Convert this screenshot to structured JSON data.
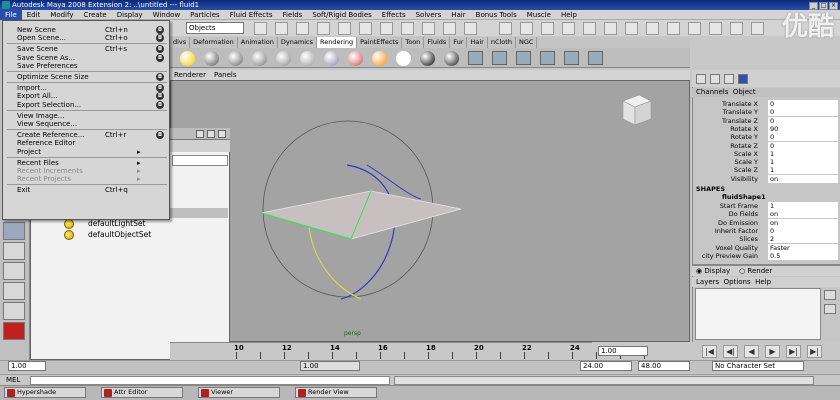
{
  "window": {
    "title": "Autodesk Maya 2008 Extension 2: ..\\untitled  ---  fluid1",
    "controls": [
      "_",
      "□",
      "×"
    ]
  },
  "menubar": [
    "File",
    "Edit",
    "Modify",
    "Create",
    "Display",
    "Window",
    "Particles",
    "Fluid Effects",
    "Fields",
    "Soft/Rigid Bodies",
    "Effects",
    "Solvers",
    "Hair",
    "Bonus Tools",
    "Muscle",
    "Help"
  ],
  "toolbar": {
    "object_field": "Objects"
  },
  "shelf_tabs": [
    "divs",
    "Deformation",
    "Animation",
    "Dynamics",
    "Rendering",
    "PaintEffects",
    "Toon",
    "Fluids",
    "Fur",
    "Hair",
    "nCloth",
    "NGC"
  ],
  "shelf_current": "Rendering",
  "viewport": {
    "menus": [
      "Renderer",
      "Panels"
    ],
    "camera_label": "persp"
  },
  "file_menu": {
    "items": [
      {
        "label": "New Scene",
        "shortcut": "Ctrl+n",
        "option": true
      },
      {
        "label": "Open Scene...",
        "shortcut": "Ctrl+o",
        "option": true
      },
      {
        "sep": true
      },
      {
        "label": "Save Scene",
        "shortcut": "Ctrl+s",
        "option": true
      },
      {
        "label": "Save Scene As...",
        "shortcut": "",
        "option": true
      },
      {
        "label": "Save Preferences",
        "shortcut": "",
        "option": false
      },
      {
        "sep": true
      },
      {
        "label": "Optimize Scene Size",
        "shortcut": "",
        "option": true
      },
      {
        "sep": true
      },
      {
        "label": "Import...",
        "shortcut": "",
        "option": true
      },
      {
        "label": "Export All...",
        "shortcut": "",
        "option": true
      },
      {
        "label": "Export Selection...",
        "shortcut": "",
        "option": true
      },
      {
        "sep": true
      },
      {
        "label": "View Image...",
        "shortcut": "",
        "option": false
      },
      {
        "label": "View Sequence...",
        "shortcut": "",
        "option": false
      },
      {
        "sep": true
      },
      {
        "label": "Create Reference...",
        "shortcut": "Ctrl+r",
        "option": true
      },
      {
        "label": "Reference Editor",
        "shortcut": "",
        "option": false
      },
      {
        "label": "Project",
        "shortcut": "",
        "option": false,
        "submenu": true
      },
      {
        "sep": true
      },
      {
        "label": "Recent Files",
        "shortcut": "",
        "option": false,
        "submenu": true
      },
      {
        "label": "Recent Increments",
        "shortcut": "",
        "option": false,
        "submenu": true,
        "disabled": true
      },
      {
        "label": "Recent Projects",
        "shortcut": "",
        "option": false,
        "submenu": true,
        "disabled": true
      },
      {
        "sep": true
      },
      {
        "label": "Exit",
        "shortcut": "Ctrl+q",
        "option": false
      }
    ]
  },
  "outliner": {
    "items": [
      "defaultLightSet",
      "defaultObjectSet"
    ]
  },
  "channel_box": {
    "header": [
      "Channels",
      "Object"
    ],
    "transform": [
      {
        "label": "Translate X",
        "value": "0"
      },
      {
        "label": "Translate Y",
        "value": "0"
      },
      {
        "label": "Translate Z",
        "value": "0"
      },
      {
        "label": "Rotate X",
        "value": "90"
      },
      {
        "label": "Rotate Y",
        "value": "0"
      },
      {
        "label": "Rotate Z",
        "value": "0"
      },
      {
        "label": "Scale X",
        "value": "1"
      },
      {
        "label": "Scale Y",
        "value": "1"
      },
      {
        "label": "Scale Z",
        "value": "1"
      },
      {
        "label": "Visibility",
        "value": "on"
      }
    ],
    "shapes_label": "SHAPES",
    "shape_name": "fluidShape1",
    "shape_attrs": [
      {
        "label": "Start Frame",
        "value": "1"
      },
      {
        "label": "Do Fields",
        "value": "on"
      },
      {
        "label": "Do Emission",
        "value": "on"
      },
      {
        "label": "Inherit Factor",
        "value": "0"
      },
      {
        "label": "Slices",
        "value": "2"
      },
      {
        "label": "Voxel Quality",
        "value": "Faster"
      },
      {
        "label": "city Preview Gain",
        "value": "0.5"
      }
    ],
    "display_tabs": [
      "Display",
      "Render"
    ],
    "layer_menus": [
      "Layers",
      "Options",
      "Help"
    ]
  },
  "timeline": {
    "ticks": [
      "10",
      "12",
      "14",
      "16",
      "18",
      "20",
      "22",
      "24"
    ],
    "current_frame": "1.00"
  },
  "range": {
    "start": "1.00",
    "end_a": "24.00",
    "end_b": "48.00",
    "character_set": "No Character Set",
    "inner_field": "1.00"
  },
  "command_line": {
    "label": "MEL"
  },
  "taskbar": [
    "Hypershade",
    "Attr Editor",
    "Viewer",
    "Render View"
  ],
  "watermark": "优酷"
}
